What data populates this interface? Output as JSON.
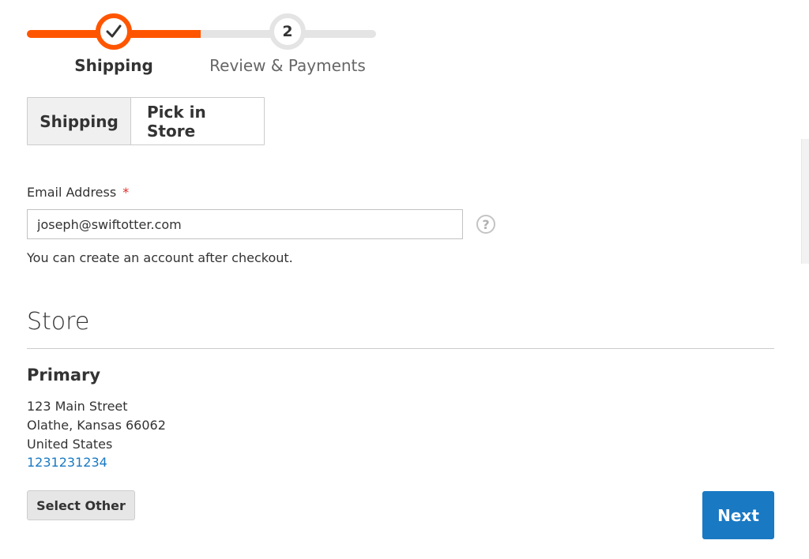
{
  "progress": {
    "step1_label": "Shipping",
    "step2_number": "2",
    "step2_label": "Review & Payments",
    "fraction_complete": 0.5,
    "accent_color": "#ff5501"
  },
  "method_tabs": [
    {
      "label": "Shipping",
      "active": true
    },
    {
      "label": "Pick in Store",
      "active": false
    }
  ],
  "email": {
    "label": "Email Address",
    "required_mark": "*",
    "value": "joseph@swiftotter.com",
    "help_icon": "question-circle-icon",
    "note": "You can create an account after checkout."
  },
  "store": {
    "section_title": "Store",
    "name": "Primary",
    "street": "123 Main Street",
    "city_line": "Olathe, Kansas 66062",
    "country": "United States",
    "phone": "1231231234"
  },
  "buttons": {
    "select_other": "Select Other",
    "next": "Next",
    "primary_color": "#1979c3"
  }
}
